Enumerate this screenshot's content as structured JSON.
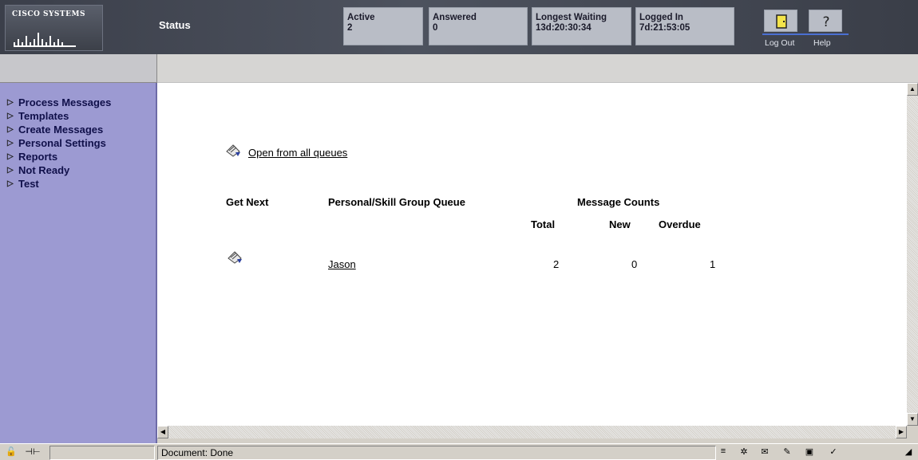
{
  "header": {
    "logo_text": "Cisco Systems",
    "title": "Status",
    "stats": [
      {
        "label": "Active",
        "value": "2"
      },
      {
        "label": "Answered",
        "value": "0"
      },
      {
        "label": "Longest Waiting",
        "value": "13d:20:30:34"
      },
      {
        "label": "Logged In",
        "value": "7d:21:53:05"
      }
    ],
    "tools": {
      "logout_label": "Log Out",
      "help_label": "Help"
    }
  },
  "sidebar": {
    "items": [
      {
        "label": "Process Messages"
      },
      {
        "label": "Templates"
      },
      {
        "label": "Create Messages"
      },
      {
        "label": "Personal Settings"
      },
      {
        "label": "Reports"
      },
      {
        "label": "Not Ready"
      },
      {
        "label": "Test"
      }
    ]
  },
  "main": {
    "open_all_label": "Open from all queues",
    "headers": {
      "get_next": "Get Next",
      "queue": "Personal/Skill Group Queue",
      "message_counts": "Message Counts",
      "total": "Total",
      "new": "New",
      "overdue": "Overdue"
    },
    "rows": [
      {
        "queue": "Jason",
        "total": "2",
        "new": "0",
        "overdue": "1"
      }
    ]
  },
  "statusbar": {
    "text": "Document: Done"
  },
  "colors": {
    "sidebar": "#9c9ad2",
    "header": "#4d525e",
    "stat_box": "#b9bdc6"
  }
}
